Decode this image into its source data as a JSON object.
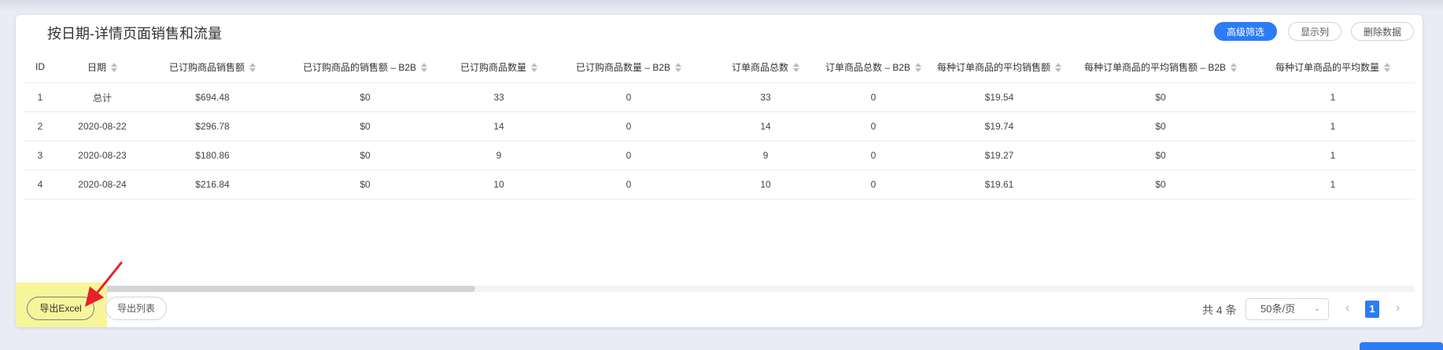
{
  "title": "按日期-详情页面销售和流量",
  "toolbar": {
    "filter_label": "高级筛选",
    "columns_label": "显示列",
    "delete_label": "删除数据"
  },
  "table": {
    "columns": [
      "ID",
      "日期",
      "已订购商品销售额",
      "已订购商品的销售额 – B2B",
      "已订购商品数量",
      "已订购商品数量 – B2B",
      "订单商品总数",
      "订单商品总数 – B2B",
      "每种订单商品的平均销售额",
      "每种订单商品的平均销售额 – B2B",
      "每种订单商品的平均数量"
    ],
    "rows": [
      [
        "1",
        "总计",
        "$694.48",
        "$0",
        "33",
        "0",
        "33",
        "0",
        "$19.54",
        "$0",
        "1"
      ],
      [
        "2",
        "2020-08-22",
        "$296.78",
        "$0",
        "14",
        "0",
        "14",
        "0",
        "$19.74",
        "$0",
        "1"
      ],
      [
        "3",
        "2020-08-23",
        "$180.86",
        "$0",
        "9",
        "0",
        "9",
        "0",
        "$19.27",
        "$0",
        "1"
      ],
      [
        "4",
        "2020-08-24",
        "$216.84",
        "$0",
        "10",
        "0",
        "10",
        "0",
        "$19.61",
        "$0",
        "1"
      ]
    ]
  },
  "footer": {
    "export_excel_label": "导出Excel",
    "export_list_label": "导出列表",
    "total_label": "共 4 条",
    "page_size_label": "50条/页",
    "current_page": "1"
  },
  "icons": {
    "sort": "sort-icon",
    "prev": "chevron-left-icon",
    "next": "chevron-right-icon",
    "dropdown": "chevron-down-icon",
    "arrow": "red-arrow-icon"
  },
  "colors": {
    "accent": "#2d7cf6",
    "highlight": "#f7f59a",
    "arrow": "#e8202a"
  }
}
